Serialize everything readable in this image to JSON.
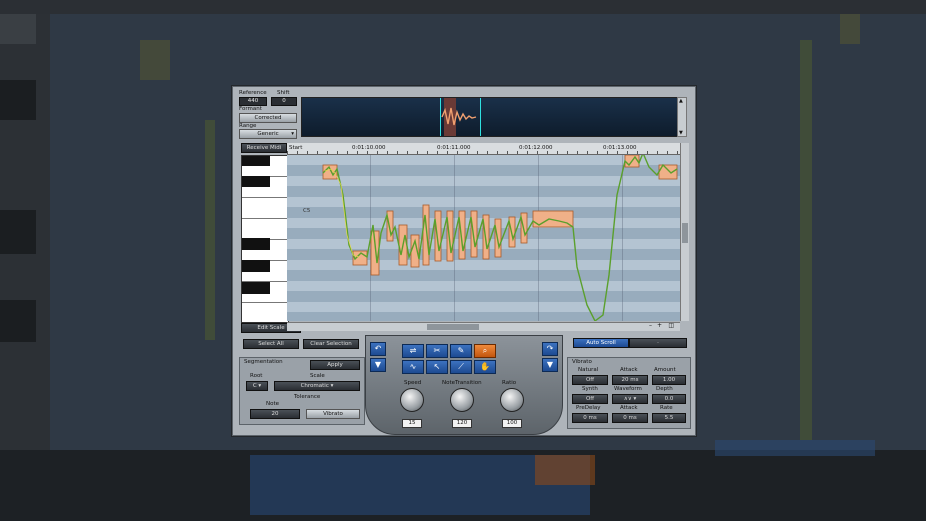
{
  "top": {
    "reference_label": "Reference",
    "shift_label": "Shift",
    "reference_value": "440",
    "shift_value": "0",
    "formant_label": "Formant",
    "formant_value": "Corrected",
    "range_label": "Range",
    "range_value": "Generic"
  },
  "timeline": {
    "receive_midi": "Receive Midi",
    "start_label": "Start",
    "marks": [
      "0:01:10.000",
      "0:01:11.000",
      "0:01:12.000",
      "0:01:13.000"
    ],
    "note_label": "C5",
    "edit_scale": "Edit Scale"
  },
  "bottom": {
    "select_all": "Select All",
    "clear_selection": "Clear Selection",
    "auto_scroll": "Auto Scroll",
    "segmentation_title": "Segmentation",
    "apply": "Apply",
    "root_label": "Root",
    "root_value": "C",
    "scale_label": "Scale",
    "scale_value": "Chromatic",
    "tolerance_label": "Tolerance",
    "note_label": "Note",
    "note_value": "20",
    "vibrato_button": "Vibrato",
    "speed_label": "Speed",
    "speed_value": "15",
    "note_transition_label": "NoteTransition",
    "note_transition_value": "120",
    "ratio_label": "Ratio",
    "ratio_value": "100",
    "vibrato_title": "Vibrato",
    "natural_label": "Natural",
    "natural_value": "Off",
    "attack_label": "Attack",
    "attack_value": "20 ms",
    "amount_label": "Amount",
    "amount_value": "1.00",
    "synth_label": "Synth",
    "synth_value": "Off",
    "waveform_label": "Waveform",
    "depth_label": "Depth",
    "depth_value": "0.0",
    "predelay_label": "PreDelay",
    "predelay_value": "0 ms",
    "attack2_label": "Attack",
    "attack2_value": "0 ms",
    "rate_label": "Rate",
    "rate_value": "5.5"
  },
  "colors": {
    "note_fill": "#f0b088",
    "pitch_line": "#5aa02c",
    "tool_selected": "#e06a14"
  }
}
